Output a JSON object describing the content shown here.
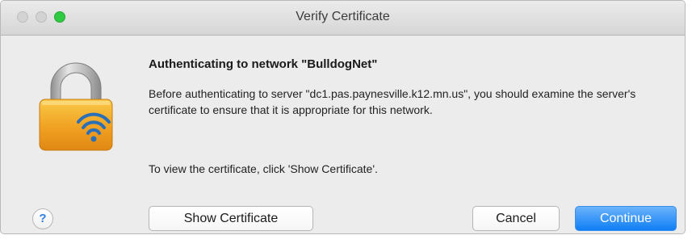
{
  "window": {
    "title": "Verify Certificate"
  },
  "icons": {
    "lock": "lock-wifi-icon",
    "help": "help-icon"
  },
  "dialog": {
    "heading": "Authenticating to network \"BulldogNet\"",
    "message": "Before authenticating to server \"dc1.pas.paynesville.k12.mn.us\", you should examine the server's certificate to ensure that it is appropriate for this network.",
    "message2": "To view the certificate, click 'Show Certificate'.",
    "help_label": "?"
  },
  "buttons": {
    "show_certificate": "Show Certificate",
    "cancel": "Cancel",
    "continue": "Continue"
  },
  "colors": {
    "accent": "#1a85f7",
    "lock_gold": "#f0a020"
  }
}
